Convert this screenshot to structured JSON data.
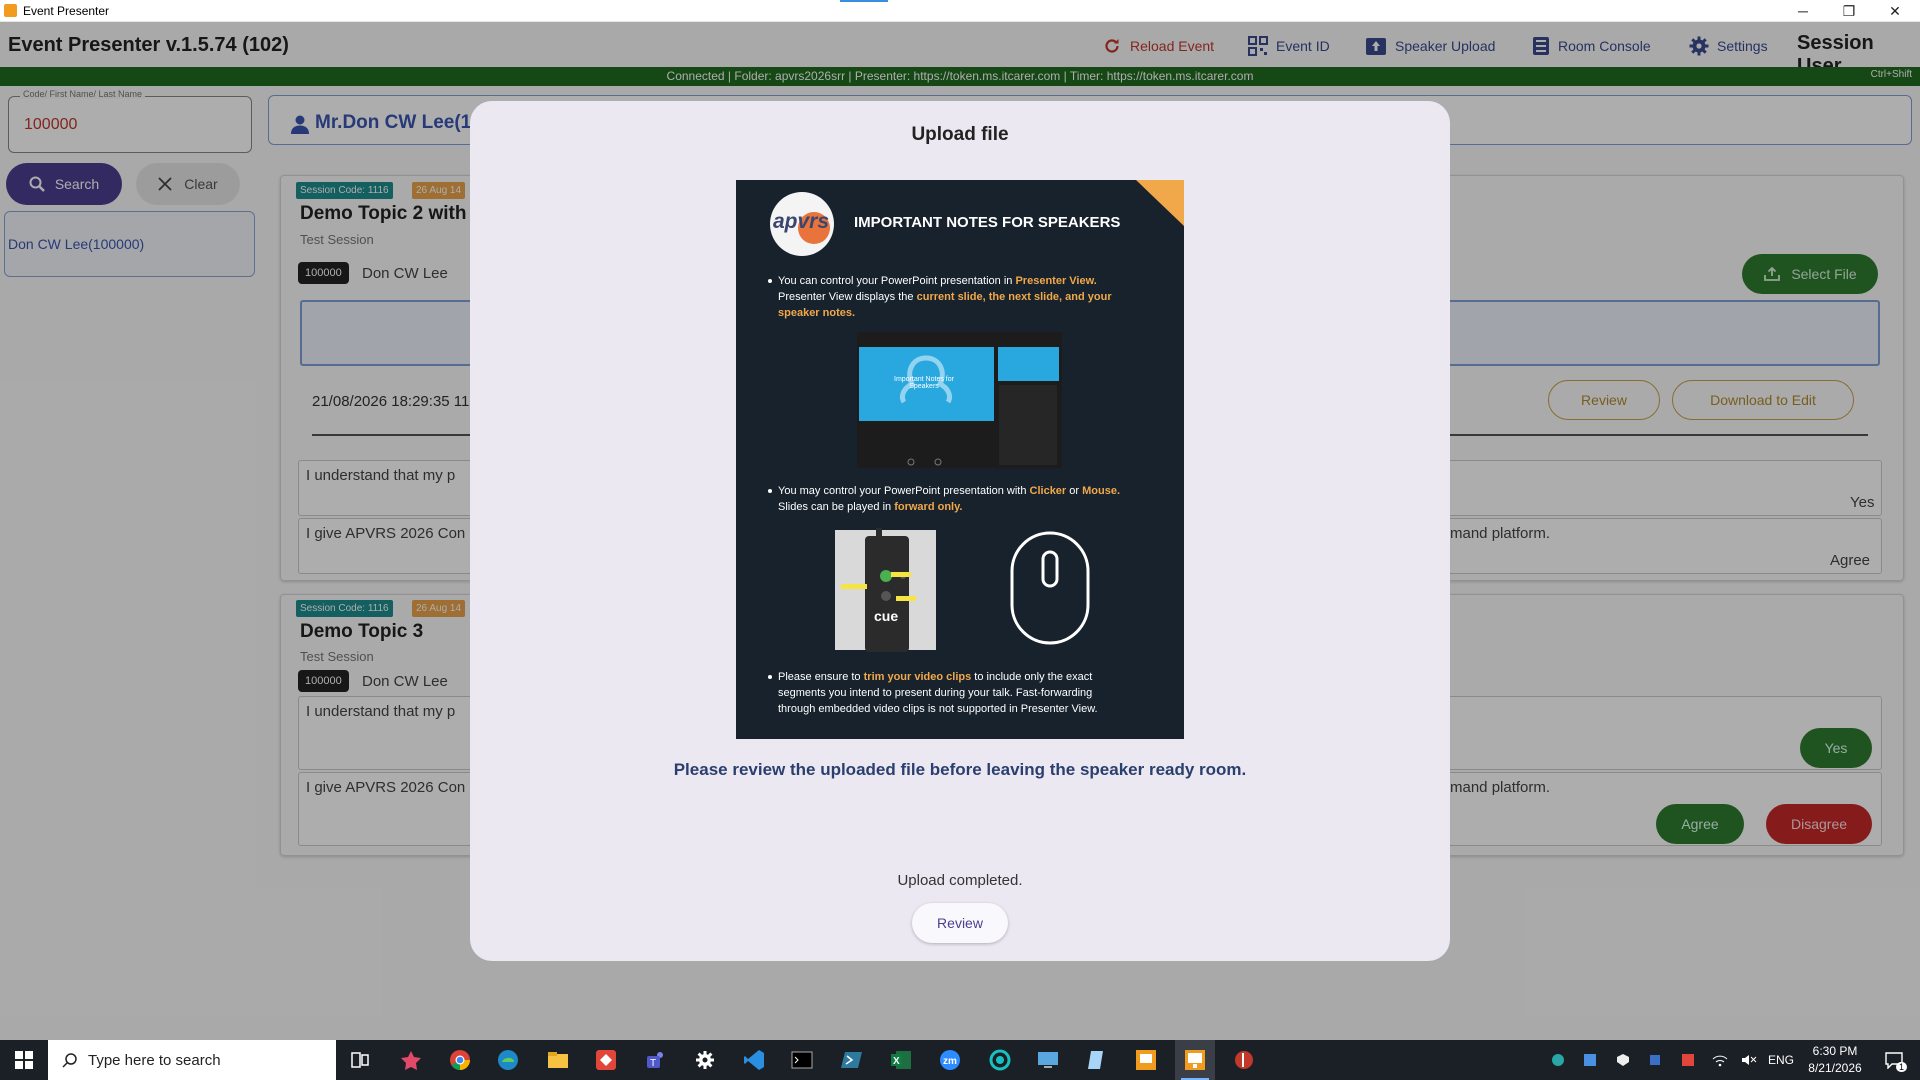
{
  "window": {
    "title": "Event Presenter",
    "minimize_glyph": "─",
    "restore_glyph": "❐",
    "close_glyph": "✕"
  },
  "header": {
    "app_title": "Event Presenter v.1.5.74 (102)",
    "nav": [
      {
        "label": "Reload Event",
        "icon": "reload-icon"
      },
      {
        "label": "Event ID",
        "icon": "qr-icon"
      },
      {
        "label": "Speaker Upload",
        "icon": "upload-box-icon"
      },
      {
        "label": "Room Console",
        "icon": "console-icon"
      },
      {
        "label": "Settings",
        "icon": "gear-icon"
      }
    ],
    "session_user": "Session User"
  },
  "status_bar": {
    "text": "Connected | Folder: apvrs2026srr | Presenter: https://token.ms.itcarer.com | Timer: https://token.ms.itcarer.com",
    "shortcut": "Ctrl+Shift",
    "color": "#1f6b1f"
  },
  "search_panel": {
    "field_label": "Code/ First Name/ Last Name",
    "field_value": "100000",
    "search_label": "Search",
    "clear_label": "Clear",
    "results": [
      "Don CW Lee(100000)"
    ]
  },
  "speaker": {
    "name": "Mr.Don CW Lee(1"
  },
  "sessions": [
    {
      "code": "Session Code: 1116",
      "date": "26 Aug 14",
      "title": "Demo Topic 2 with",
      "subtitle": "Test Session",
      "id": "100000",
      "person": "Don CW Lee",
      "select_file": "Select File",
      "timestamp": "21/08/2026 18:29:35 11",
      "review": "Review",
      "download": "Download to Edit",
      "statement1_start": "I understand that my p",
      "statement1_answer": "Yes",
      "statement2_start": "I give APVRS 2026 Con",
      "statement2_end": "mand platform.",
      "statement2_answer": "Agree"
    },
    {
      "code": "Session Code: 1116",
      "date": "26 Aug 14",
      "title": "Demo Topic 3",
      "subtitle": "Test Session",
      "id": "100000",
      "person": "Don CW Lee",
      "statement1_start": "I understand that my p",
      "yes_button": "Yes",
      "statement2_start": "I give APVRS 2026 Con",
      "statement2_end": "mand platform.",
      "agree_button": "Agree",
      "disagree_button": "Disagree"
    }
  ],
  "modal": {
    "title": "Upload file",
    "poster": {
      "logo_text": "apvrs",
      "heading": "IMPORTANT NOTES FOR SPEAKERS",
      "bullet1_line1": "You can control your PowerPoint presentation in",
      "bullet1_hl1": "Presenter View.",
      "bullet1_line2": "Presenter View displays the",
      "bullet1_hl2": "current slide, the next slide, and your",
      "bullet1_hl3": "speaker notes.",
      "screen_caption": "Important Notes for Speakers",
      "bullet2_line1": "You may control your PowerPoint presentation with",
      "bullet2_hl1": "Clicker",
      "bullet2_or": "or",
      "bullet2_hl2": "Mouse.",
      "bullet2_line2": "Slides can be played in",
      "bullet2_hl3": "forward only.",
      "clicker_brand": "cue",
      "bullet3_line1_a": "Please ensure to",
      "bullet3_hl": "trim your video clips",
      "bullet3_line1_b": "to include only the exact",
      "bullet3_line2": "segments you intend to present during your talk. Fast-forwarding",
      "bullet3_line3": "through embedded video clips is not supported in Presenter View.",
      "accent_color": "#f0a84a"
    },
    "review_message": "Please review the uploaded file before leaving the speaker ready room.",
    "upload_status": "Upload completed.",
    "review_button": "Review"
  },
  "taskbar": {
    "search_placeholder": "Type here to search",
    "tray_language": "ENG",
    "time": "6:30 PM",
    "date": "8/21/2026",
    "notification_count": "1"
  }
}
